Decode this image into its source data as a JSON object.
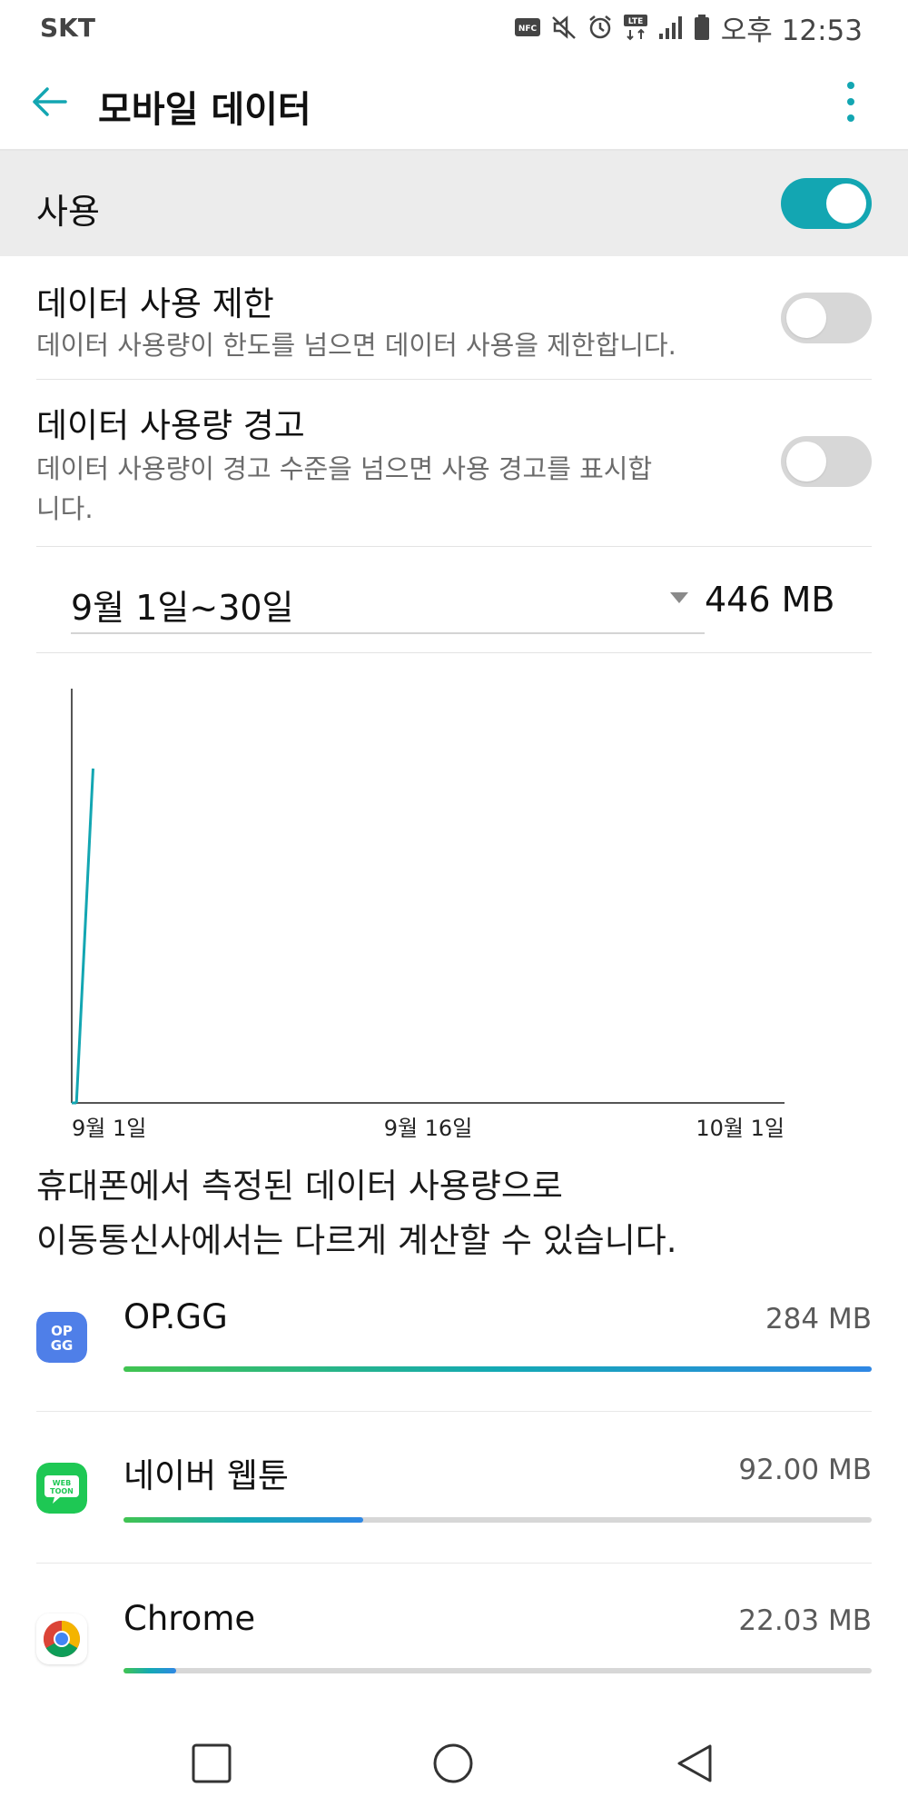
{
  "status_bar": {
    "carrier": "SKT",
    "nfc_label": "NFC",
    "lte_label": "LTE",
    "time": "오후 12:53"
  },
  "appbar": {
    "title": "모바일 데이터"
  },
  "master_toggle": {
    "label": "사용",
    "on": true
  },
  "settings": [
    {
      "title": "데이터 사용 제한",
      "desc": "데이터 사용량이 한도를 넘으면 데이터 사용을 제한합니다.",
      "on": false
    },
    {
      "title": "데이터 사용량 경고",
      "desc": "데이터 사용량이 경고 수준을 넘으면 사용 경고를 표시합니다.",
      "on": false
    }
  ],
  "cycle": {
    "label": "9월 1일~30일",
    "total": "446 MB"
  },
  "chart_data": {
    "type": "line",
    "x_ticks": [
      "9월 1일",
      "9월 16일",
      "10월 1일"
    ],
    "x_range": [
      0,
      30
    ],
    "y_range": [
      0,
      446
    ],
    "series": [
      {
        "x": [
          0,
          0.2
        ],
        "y": [
          0,
          0
        ]
      },
      {
        "x": [
          0.2,
          0.9
        ],
        "y": [
          0,
          360
        ]
      }
    ],
    "color": "#13a6b2"
  },
  "note": {
    "line1": "휴대폰에서 측정된 데이터 사용량으로",
    "line2": "이동통신사에서는 다르게 계산할 수 있습니다."
  },
  "apps": [
    {
      "name": "OP.GG",
      "size": "284 MB",
      "fraction": 1.0,
      "icon": "opgg-icon",
      "icon_text": "OP GG"
    },
    {
      "name": "네이버 웹툰",
      "size": "92.00 MB",
      "fraction": 0.32,
      "icon": "naver-webtoon-icon",
      "icon_text": "WEB TOON"
    },
    {
      "name": "Chrome",
      "size": "22.03 MB",
      "fraction": 0.07,
      "icon": "chrome-icon"
    }
  ],
  "colors": {
    "accent": "#13a6b2",
    "opgg_blue": "#4f7fe8",
    "webtoon_green": "#1ec854"
  }
}
